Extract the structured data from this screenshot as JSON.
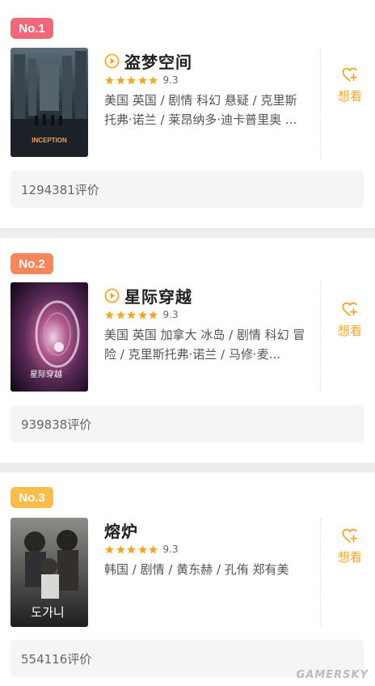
{
  "colors": {
    "rank_1": "#f2687b",
    "rank_2": "#f8865a",
    "rank_3": "#fbbd48",
    "accent": "#f5a623",
    "star": "#f5a623"
  },
  "icons": {
    "play": "play-circle-icon",
    "star": "star-icon",
    "want": "heart-plus-icon"
  },
  "movies": [
    {
      "rank": "No.1",
      "title": "盗梦空间",
      "has_play": true,
      "stars": 5,
      "score": "9.3",
      "desc": "美国 英国 / 剧情 科幻 悬疑 / 克里斯托弗·诺兰 / 莱昂纳多·迪卡普里奥 ...",
      "want_label": "想看",
      "reviews": "1294381评价",
      "poster_text": "INCEPTION"
    },
    {
      "rank": "No.2",
      "title": "星际穿越",
      "has_play": true,
      "stars": 5,
      "score": "9.3",
      "desc": "美国 英国 加拿大 冰岛 / 剧情 科幻 冒险 / 克里斯托弗·诺兰 / 马修·麦...",
      "want_label": "想看",
      "reviews": "939838评价",
      "poster_text": "星际穿越"
    },
    {
      "rank": "No.3",
      "title": "熔炉",
      "has_play": false,
      "stars": 5,
      "score": "9.3",
      "desc": "韩国 / 剧情 / 黄东赫 / 孔侑 郑有美",
      "want_label": "想看",
      "reviews": "554116评价",
      "poster_text": "도가니"
    }
  ],
  "watermark": "GAMERSKY"
}
